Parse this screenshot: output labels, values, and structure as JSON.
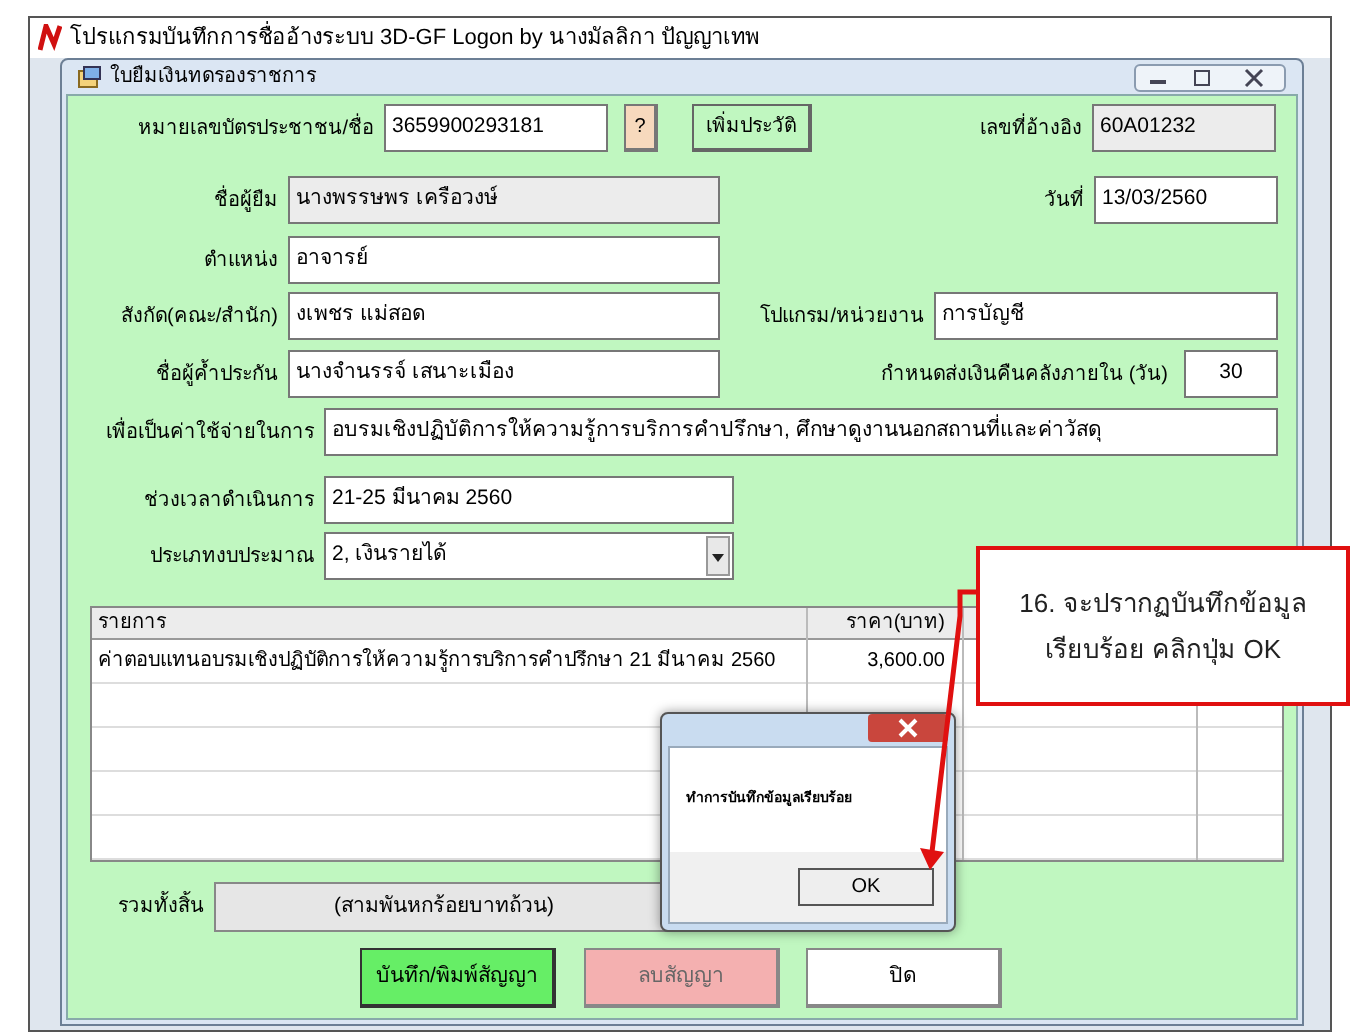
{
  "app_window": {
    "title": "โปรแกรมบันทึกการชื่ออ้างระบบ 3D-GF Logon by นางมัลลิกา  ปัญญาเทพ"
  },
  "dialog": {
    "title": "ใบยืมเงินทดรองราชการ"
  },
  "form": {
    "id_card": {
      "label": "หมายเลขบัตรประชาชน/ชื่อ",
      "value": "3659900293181"
    },
    "lookup_button": "?",
    "add_history_button": "เพิ่มประวัติ",
    "reference_no": {
      "label": "เลขที่อ้างอิง",
      "value": "60A01232"
    },
    "borrower": {
      "label": "ชื่อผู้ยืม",
      "value": "นางพรรษพร  เครือวงษ์"
    },
    "date": {
      "label": "วันที่",
      "value": "13/03/2560"
    },
    "position": {
      "label": "ตำแหน่ง",
      "value": "อาจารย์"
    },
    "affiliation": {
      "label": "สังกัด(คณะ/สำนัก)",
      "value": "งเพชร แม่สอด"
    },
    "program": {
      "label": "โปแกรม/หน่วยงาน",
      "value": "การบัญชี"
    },
    "guarantor": {
      "label": "ชื่อผู้ค้ำประกัน",
      "value": "นางจำนรรจ์  เสนาะเมือง"
    },
    "return_days": {
      "label": "กำหนดส่งเงินคืนคลังภายใน (วัน)",
      "value": "30"
    },
    "purpose": {
      "label": "เพื่อเป็นค่าใช้จ่ายในการ",
      "value": "อบรมเชิงปฏิบัติการให้ความรู้การบริการคำปรึกษา, ศึกษาดูงานนอกสถานที่และค่าวัสดุ"
    },
    "period": {
      "label": "ช่วงเวลาดำเนินการ",
      "value": "21-25 มีนาคม 2560"
    },
    "budget_type": {
      "label": "ประเภทงบประมาณ",
      "value": "2, เงินรายได้"
    }
  },
  "table": {
    "columns": [
      "รายการ",
      "ราคา(บาท)"
    ],
    "rows": [
      {
        "cells": [
          "ค่าตอบแทนอบรมเชิงปฏิบัติการให้ความรู้การบริการคำปรึกษา 21 มีนาคม 2560",
          "3,600.00"
        ]
      }
    ]
  },
  "total": {
    "label": "รวมทั้งสิ้น",
    "value": "(สามพันหกร้อยบาทถ้วน)"
  },
  "buttons": [
    {
      "label": "บันทึก/พิมพ์สัญญา",
      "kind": "save"
    },
    {
      "label": "ลบสัญญา",
      "kind": "delete"
    },
    {
      "label": "ปิด",
      "kind": "close"
    }
  ],
  "message_box": {
    "text": "ทำการบันทึกข้อมูลเรียบร้อย",
    "ok_button": "OK"
  },
  "callout": {
    "lines": [
      "16. จะปรากฏบันทึกข้อมูล",
      "เรียบร้อย  คลิกปุ่ม OK"
    ]
  }
}
